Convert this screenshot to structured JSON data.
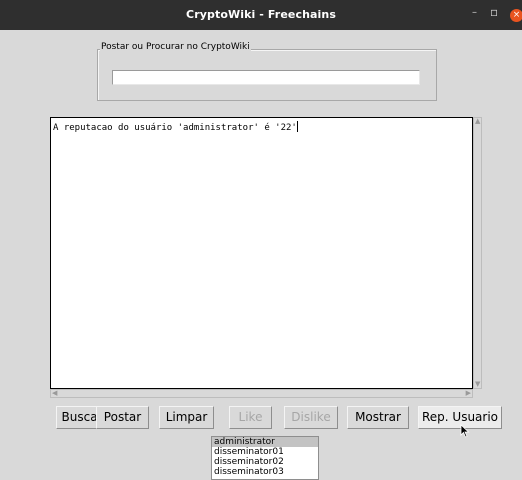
{
  "window": {
    "title": "CryptoWiki - Freechains",
    "controls": {
      "minimize": "–",
      "maximize": "▫",
      "close": "×"
    }
  },
  "search_frame": {
    "label": "Postar ou Procurar no CryptoWiki",
    "entry_value": ""
  },
  "text_area": {
    "content": "A reputacao do usuário 'administrator' é '22'"
  },
  "buttons": [
    {
      "label": "Buscar",
      "enabled": true
    },
    {
      "label": "Postar",
      "enabled": true
    },
    {
      "label": "Limpar",
      "enabled": true
    },
    {
      "label": "Like",
      "enabled": false
    },
    {
      "label": "Dislike",
      "enabled": false
    },
    {
      "label": "Mostrar",
      "enabled": true
    },
    {
      "label": "Rep. Usuario",
      "enabled": true
    }
  ],
  "user_list": {
    "items": [
      "administrator",
      "disseminator01",
      "disseminator02",
      "disseminator03"
    ],
    "selected": "administrator"
  },
  "colors": {
    "titlebar": "#2f2f2f",
    "window_bg": "#d9d9d9",
    "close_button": "#e95420"
  }
}
